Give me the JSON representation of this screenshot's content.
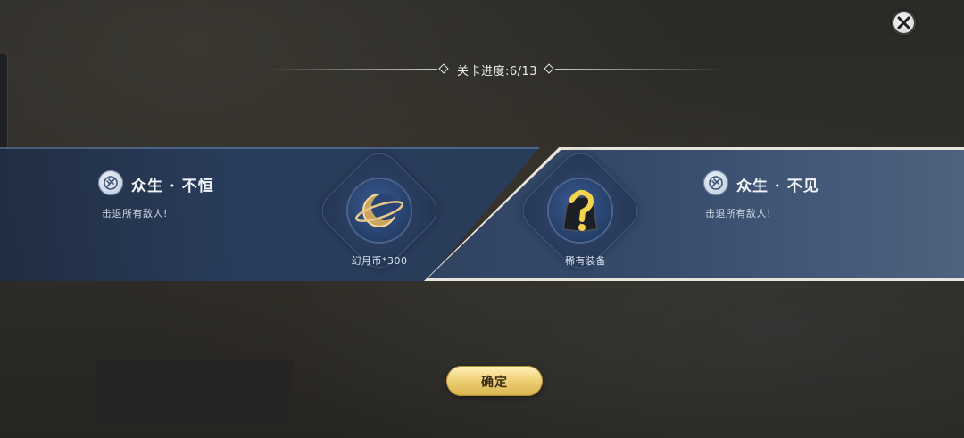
{
  "header": {
    "progress_text": "关卡进度:6/13"
  },
  "stages": [
    {
      "title": "众生 · 不恒",
      "description": "击退所有敌人!",
      "reward": {
        "label": "幻月币*300",
        "icon": "moon-coin-icon"
      },
      "selected": false
    },
    {
      "title": "众生 · 不见",
      "description": "击退所有敌人!",
      "reward": {
        "label": "稀有装备",
        "icon": "mystery-equipment-icon"
      },
      "selected": true
    }
  ],
  "buttons": {
    "confirm_label": "确定"
  },
  "colors": {
    "accent_gold": "#f1d27a",
    "card_blue": "#2c4266",
    "selected_border": "#e9e4da"
  }
}
